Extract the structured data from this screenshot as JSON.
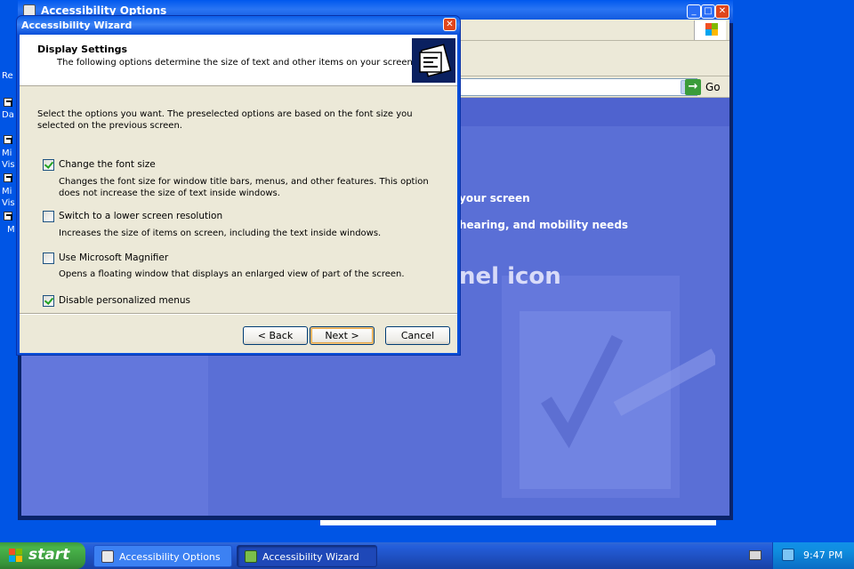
{
  "background_window": {
    "title": "Accessibility Options",
    "address_go_label": "Go",
    "content_line_1": "your screen",
    "content_line_2": "hearing, and mobility needs",
    "content_line_3": "nel icon"
  },
  "desktop": {
    "icon_fragments": [
      "Re",
      "Da",
      "Mi",
      "Vis",
      "Mi",
      "Vis",
      "M"
    ]
  },
  "wizard": {
    "title": "Accessibility Wizard",
    "heading": "Display Settings",
    "subheading": "The following options determine the size of text and other items on your screen.",
    "intro": "Select the options you want.  The preselected options are based on the font size you selected on the previous screen.",
    "options": [
      {
        "label": "Change the font size",
        "checked": true,
        "description": "Changes the font size for window title bars, menus, and other features.  This option does not increase the size of text inside windows."
      },
      {
        "label": "Switch to a lower screen resolution",
        "checked": false,
        "description": "Increases the size of items on screen, including the text inside windows."
      },
      {
        "label": "Use Microsoft Magnifier",
        "checked": false,
        "description": "Opens a floating window that displays an enlarged view of part of the screen."
      },
      {
        "label": "Disable personalized menus",
        "checked": true,
        "description": ""
      }
    ],
    "buttons": {
      "back": "< Back",
      "next": "Next >",
      "cancel": "Cancel"
    }
  },
  "taskbar": {
    "start_label": "start",
    "tasks": [
      {
        "label": "Accessibility Options",
        "active": false
      },
      {
        "label": "Accessibility Wizard",
        "active": true
      }
    ],
    "clock": "9:47 PM"
  },
  "colors": {
    "desktop_blue": "#0055e5",
    "title_blue": "#0a4fd9",
    "dialog_face": "#ece9d8",
    "start_green": "#3c9a3c"
  }
}
